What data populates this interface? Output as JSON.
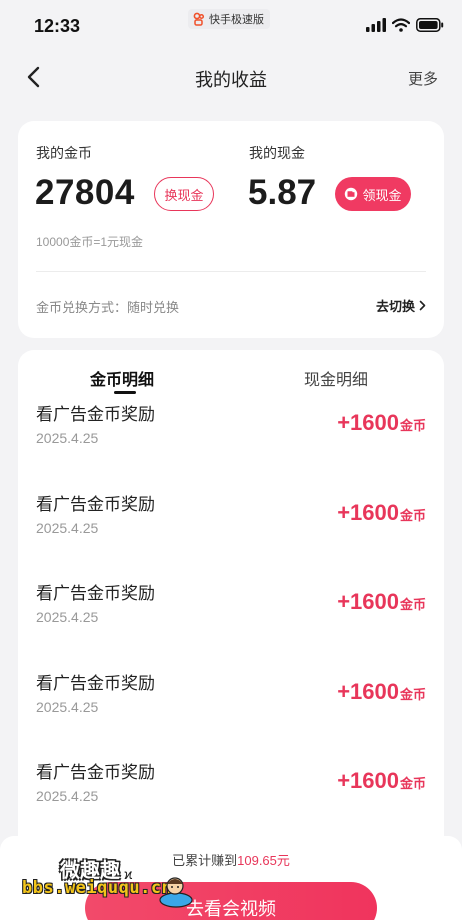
{
  "status_bar": {
    "time": "12:33",
    "app_name": "快手极速版"
  },
  "nav": {
    "title": "我的收益",
    "more_label": "更多"
  },
  "summary": {
    "coin_label": "我的金币",
    "coin_value": "27804",
    "exchange_label": "换现金",
    "cash_label": "我的现金",
    "cash_value": "5.87",
    "withdraw_label": "领现金",
    "rate_text": "10000金币=1元现金",
    "method_text": "金币兑换方式：随时兑换",
    "switch_label": "去切换"
  },
  "tabs": [
    {
      "label": "金币明细",
      "active": true
    },
    {
      "label": "现金明细",
      "active": false
    }
  ],
  "records": [
    {
      "title": "看广告金币奖励",
      "date": "2025.4.25",
      "amount": "+1600",
      "unit": "金币"
    },
    {
      "title": "看广告金币奖励",
      "date": "2025.4.25",
      "amount": "+1600",
      "unit": "金币"
    },
    {
      "title": "看广告金币奖励",
      "date": "2025.4.25",
      "amount": "+1600",
      "unit": "金币"
    },
    {
      "title": "看广告金币奖励",
      "date": "2025.4.25",
      "amount": "+1600",
      "unit": "金币"
    },
    {
      "title": "看广告金币奖励",
      "date": "2025.4.25",
      "amount": "+1600",
      "unit": "金币"
    }
  ],
  "bottom": {
    "earned_prefix": "已累计赚到",
    "earned_amount": "109.65元",
    "watch_button_label": "去看会视频"
  },
  "watermark": {
    "text": "微趣趣",
    "url": "bbs.weiququ.cn"
  },
  "colors": {
    "accent": "#e8365a",
    "accent_fill": "#f03a62",
    "background": "#f3f3f5"
  }
}
